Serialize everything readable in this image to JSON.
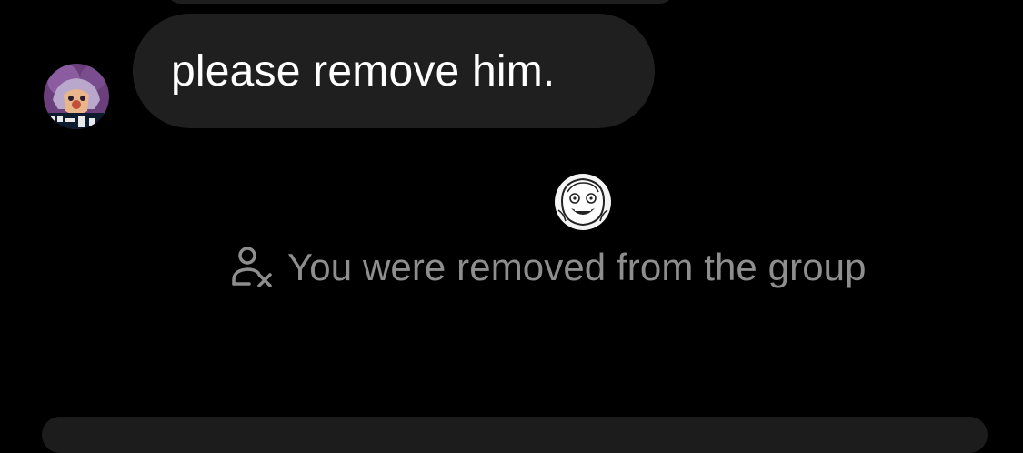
{
  "chat": {
    "message": {
      "text": "please remove him."
    },
    "system_notice": {
      "text": "You were removed from the group",
      "icon": "person-remove-icon"
    }
  },
  "colors": {
    "background": "#000000",
    "bubble": "#1f1f1f",
    "message_text": "#ffffff",
    "system_text": "#8e8e8e"
  }
}
